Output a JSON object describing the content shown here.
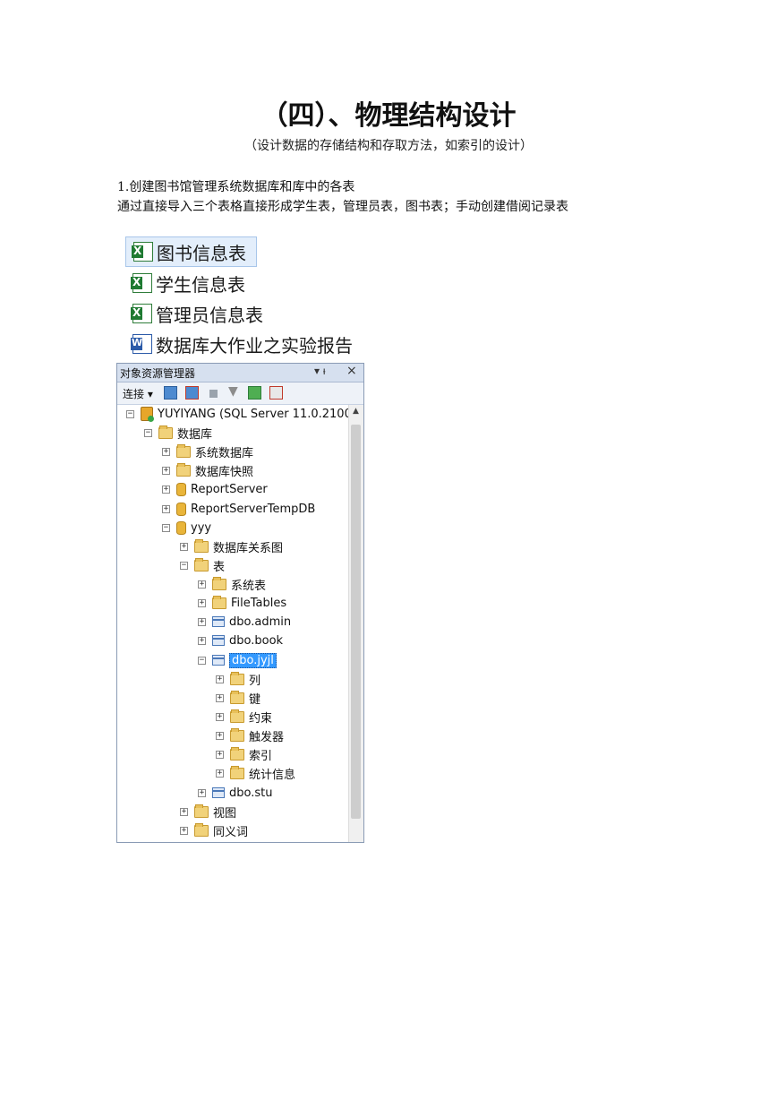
{
  "doc": {
    "title": "（四）、物理结构设计",
    "subtitle": "（设计数据的存储结构和存取方法，如索引的设计）",
    "para1": "1.创建图书馆管理系统数据库和库中的各表",
    "para2": "通过直接导入三个表格直接形成学生表，管理员表，图书表；手动创建借阅记录表"
  },
  "files": [
    {
      "name": "图书信息表",
      "icon": "excel-icon"
    },
    {
      "name": "学生信息表",
      "icon": "excel-icon"
    },
    {
      "name": "管理员信息表",
      "icon": "excel-icon"
    },
    {
      "name": "数据库大作业之实验报告",
      "icon": "word-icon"
    }
  ],
  "ssms": {
    "panel_title": "对象资源管理器",
    "pin": "▾ ᵼ",
    "close": "×",
    "toolbar_connect": "连接",
    "tree": [
      {
        "label": "YUYIYANG (SQL Server 11.0.2100",
        "exp": "−",
        "icon": "server"
      },
      {
        "label": "数据库",
        "exp": "−",
        "icon": "folder"
      },
      {
        "label": "系统数据库",
        "exp": "+",
        "icon": "folder"
      },
      {
        "label": "数据库快照",
        "exp": "+",
        "icon": "folder"
      },
      {
        "label": "ReportServer",
        "exp": "+",
        "icon": "db"
      },
      {
        "label": "ReportServerTempDB",
        "exp": "+",
        "icon": "db"
      },
      {
        "label": "yyy",
        "exp": "−",
        "icon": "db"
      },
      {
        "label": "数据库关系图",
        "exp": "+",
        "icon": "folder"
      },
      {
        "label": "表",
        "exp": "−",
        "icon": "folder"
      },
      {
        "label": "系统表",
        "exp": "+",
        "icon": "folder"
      },
      {
        "label": "FileTables",
        "exp": "+",
        "icon": "folder"
      },
      {
        "label": "dbo.admin",
        "exp": "+",
        "icon": "table"
      },
      {
        "label": "dbo.book",
        "exp": "+",
        "icon": "table"
      },
      {
        "label": "dbo.jyjl",
        "exp": "−",
        "icon": "table",
        "selected": true
      },
      {
        "label": "列",
        "exp": "+",
        "icon": "folder"
      },
      {
        "label": "键",
        "exp": "+",
        "icon": "folder"
      },
      {
        "label": "约束",
        "exp": "+",
        "icon": "folder"
      },
      {
        "label": "触发器",
        "exp": "+",
        "icon": "folder"
      },
      {
        "label": "索引",
        "exp": "+",
        "icon": "folder"
      },
      {
        "label": "统计信息",
        "exp": "+",
        "icon": "folder"
      },
      {
        "label": "dbo.stu",
        "exp": "+",
        "icon": "table"
      },
      {
        "label": "视图",
        "exp": "+",
        "icon": "folder"
      },
      {
        "label": "同义词",
        "exp": "+",
        "icon": "folder"
      }
    ]
  }
}
